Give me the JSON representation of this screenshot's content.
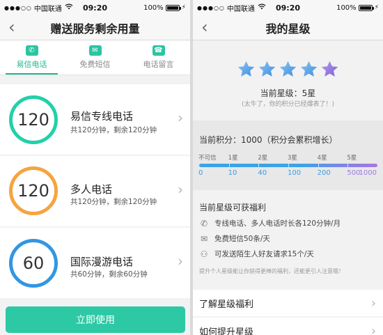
{
  "left_screen": {
    "status": {
      "signal": "●●●○○",
      "carrier": "中国联通",
      "time": "09:20",
      "battery": "100%",
      "battery_level": 1.0
    },
    "nav": {
      "back_glyph": "‹",
      "title": "赠送服务剩余用量"
    },
    "tabs": [
      {
        "label": "易信电话",
        "icon": "phone-icon",
        "glyph": "✆",
        "active": true
      },
      {
        "label": "免费短信",
        "icon": "message-icon",
        "glyph": "✉",
        "active": false
      },
      {
        "label": "电话留言",
        "icon": "voicemail-icon",
        "glyph": "☎",
        "active": false
      }
    ],
    "services": [
      {
        "count": "120",
        "name": "易信专线电话",
        "detail": "共120分钟，剩余120分钟",
        "ring_color": "#23d0a7"
      },
      {
        "count": "120",
        "name": "多人电话",
        "detail": "共120分钟，剩余120分钟",
        "ring_color": "#f5a440"
      },
      {
        "count": "60",
        "name": "国际漫游电话",
        "detail": "共60分钟，剩余60分钟",
        "ring_color": "#3296e3"
      }
    ],
    "chevron": "›",
    "use_button": "立即使用",
    "accent": "#2cc9a4"
  },
  "right_screen": {
    "status": {
      "signal": "●●●○○",
      "carrier": "中国联通",
      "time": "09:20",
      "battery": "100%",
      "battery_level": 1.0
    },
    "nav": {
      "back_glyph": "‹",
      "title": "我的星级"
    },
    "star_count": 5,
    "level_text": "当前星级：5星",
    "level_tip": "(太牛了，你的积分已经爆表了！)",
    "score_text": "当前积分：1000（积分会累积增长）",
    "levels": [
      "不可信",
      "1星",
      "2星",
      "3星",
      "4星",
      "5星"
    ],
    "thresholds": [
      "0",
      "10",
      "40",
      "100",
      "200",
      "500",
      "1000"
    ],
    "progress": 1.0,
    "benefits_title": "当前星级可获福利",
    "benefits": [
      {
        "icon": "phone-icon",
        "glyph": "✆",
        "text": "专线电话、多人电话时长各120分钟/月"
      },
      {
        "icon": "mail-icon",
        "glyph": "✉",
        "text": "免费短信50条/天"
      },
      {
        "icon": "friends-icon",
        "glyph": "⚇",
        "text": "可发送陌生人好友请求15个/天"
      }
    ],
    "benefits_note": "提升个人星级能让你获得更棒的福利，还能更引人注意哦！",
    "menu": [
      "了解星级福利",
      "如何提升星级"
    ],
    "chevron": "›"
  }
}
